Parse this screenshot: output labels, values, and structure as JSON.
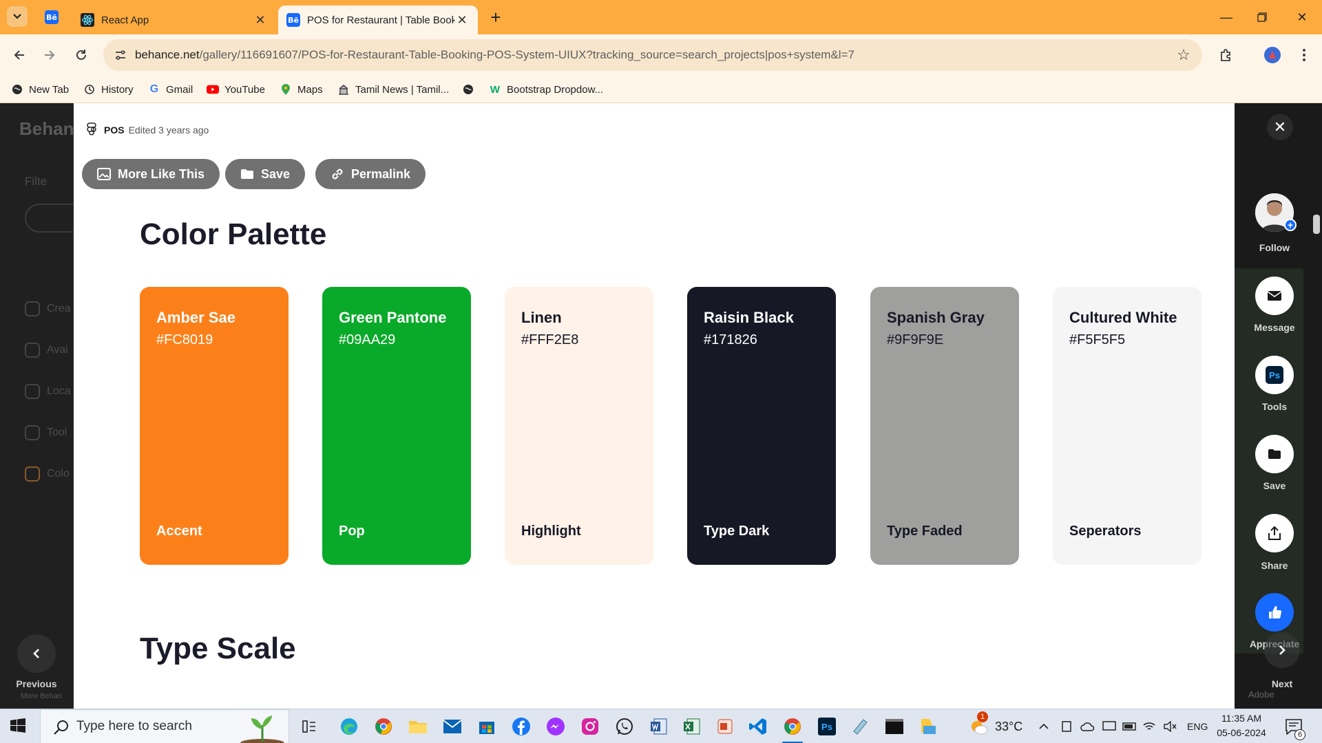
{
  "browser": {
    "tabs": [
      {
        "title": "React App"
      },
      {
        "title": "POS for Restaurant | Table Book"
      }
    ],
    "url_host": "behance.net",
    "url_path": "/gallery/116691607/POS-for-Restaurant-Table-Booking-POS-System-UIUX?tracking_source=search_projects|pos+system&l=7",
    "bookmarks": [
      {
        "label": "New Tab"
      },
      {
        "label": "History"
      },
      {
        "label": "Gmail"
      },
      {
        "label": "YouTube"
      },
      {
        "label": "Maps"
      },
      {
        "label": "Tamil News | Tamil..."
      },
      {
        "label": ""
      },
      {
        "label": "Bootstrap Dropdow..."
      }
    ]
  },
  "background": {
    "logo": "Behan",
    "filter": "Filte",
    "rows": [
      "Crea",
      "Avai",
      "Loca",
      "Tool",
      "Colo"
    ],
    "prev_label": "Previous",
    "next_label": "Next",
    "more_text": "More Behan",
    "adobe_text": "Adobe"
  },
  "modal": {
    "project_name": "POS",
    "edited": "Edited 3 years ago",
    "buttons": {
      "more_like_this": "More Like This",
      "save": "Save",
      "permalink": "Permalink"
    },
    "heading_palette": "Color Palette",
    "heading_type": "Type Scale",
    "swatches": [
      {
        "name": "Amber Sae",
        "hex": "#FC8019",
        "role": "Accent",
        "bg": "#FC8019",
        "fg": "#ffffff"
      },
      {
        "name": "Green Pantone",
        "hex": "#09AA29",
        "role": "Pop",
        "bg": "#09AA29",
        "fg": "#ffffff"
      },
      {
        "name": "Linen",
        "hex": "#FFF2E8",
        "role": "Highlight",
        "bg": "#FFF2E8",
        "fg": "#171826"
      },
      {
        "name": "Raisin Black",
        "hex": "#171826",
        "role": "Type Dark",
        "bg": "#171826",
        "fg": "#ffffff"
      },
      {
        "name": "Spanish Gray",
        "hex": "#9F9F9E",
        "role": "Type Faded",
        "bg": "#9F9F9E",
        "fg": "#171826"
      },
      {
        "name": "Cultured White",
        "hex": "#F5F5F5",
        "role": "Seperators",
        "bg": "#F5F5F5",
        "fg": "#171826"
      }
    ]
  },
  "rail": {
    "follow": "Follow",
    "message": "Message",
    "tools": "Tools",
    "tools_badge": "Ps",
    "save": "Save",
    "share": "Share",
    "appreciate": "Appreciate"
  },
  "taskbar": {
    "search_placeholder": "Type here to search",
    "temperature": "33°C",
    "language": "ENG",
    "time": "11:35 AM",
    "date": "05-06-2024",
    "weather_badge": "1",
    "notification_count": "6"
  }
}
